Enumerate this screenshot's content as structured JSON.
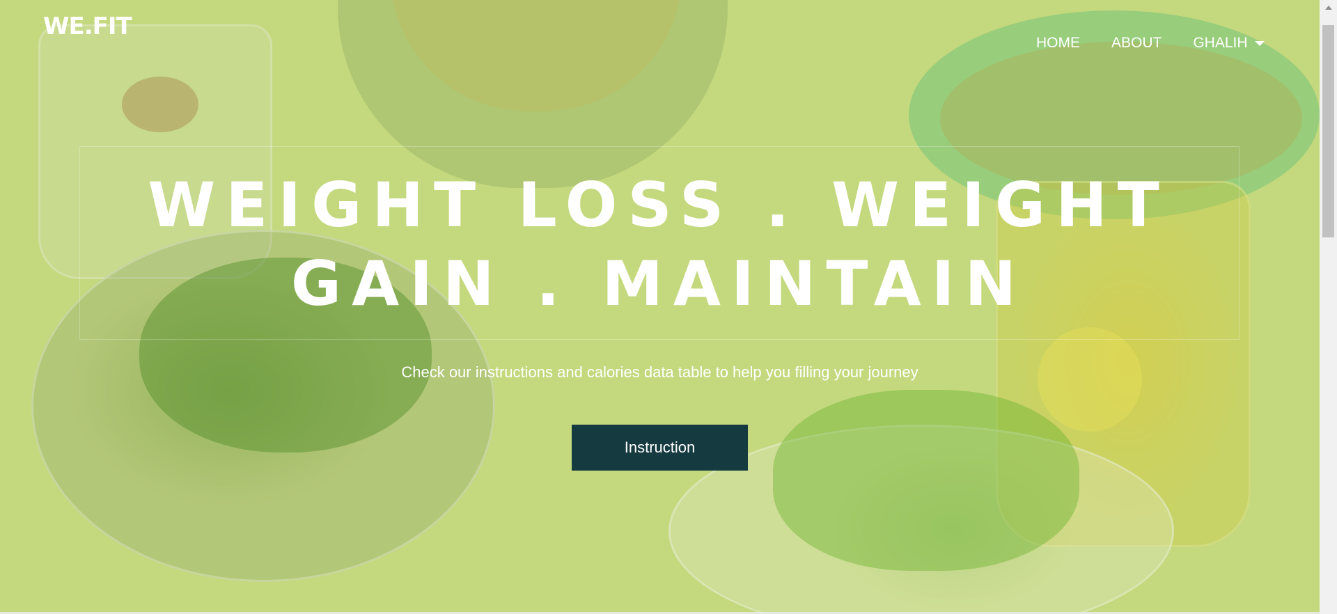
{
  "brand": {
    "logo_text": "WE.FIT"
  },
  "nav": {
    "items": [
      {
        "label": "HOME"
      },
      {
        "label": "ABOUT"
      },
      {
        "label": "GHALIH"
      }
    ]
  },
  "hero": {
    "headline": "WEIGHT LOSS . WEIGHT GAIN . MAINTAIN",
    "subtitle": "Check our instructions and calories data table to help you filling your journey",
    "cta_label": "Instruction",
    "overlay_color": "#c4d97e"
  },
  "colors": {
    "cta_background": "#153a40",
    "text": "#ffffff"
  }
}
